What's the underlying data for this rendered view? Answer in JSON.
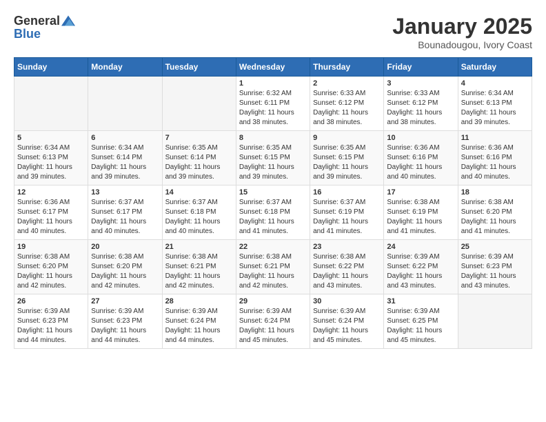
{
  "logo": {
    "general": "General",
    "blue": "Blue"
  },
  "title": "January 2025",
  "subtitle": "Bounadougou, Ivory Coast",
  "days_of_week": [
    "Sunday",
    "Monday",
    "Tuesday",
    "Wednesday",
    "Thursday",
    "Friday",
    "Saturday"
  ],
  "weeks": [
    [
      {
        "day": "",
        "info": "",
        "empty": true
      },
      {
        "day": "",
        "info": "",
        "empty": true
      },
      {
        "day": "",
        "info": "",
        "empty": true
      },
      {
        "day": "1",
        "info": "Sunrise: 6:32 AM\nSunset: 6:11 PM\nDaylight: 11 hours and 38 minutes."
      },
      {
        "day": "2",
        "info": "Sunrise: 6:33 AM\nSunset: 6:12 PM\nDaylight: 11 hours and 38 minutes."
      },
      {
        "day": "3",
        "info": "Sunrise: 6:33 AM\nSunset: 6:12 PM\nDaylight: 11 hours and 38 minutes."
      },
      {
        "day": "4",
        "info": "Sunrise: 6:34 AM\nSunset: 6:13 PM\nDaylight: 11 hours and 39 minutes."
      }
    ],
    [
      {
        "day": "5",
        "info": "Sunrise: 6:34 AM\nSunset: 6:13 PM\nDaylight: 11 hours and 39 minutes."
      },
      {
        "day": "6",
        "info": "Sunrise: 6:34 AM\nSunset: 6:14 PM\nDaylight: 11 hours and 39 minutes."
      },
      {
        "day": "7",
        "info": "Sunrise: 6:35 AM\nSunset: 6:14 PM\nDaylight: 11 hours and 39 minutes."
      },
      {
        "day": "8",
        "info": "Sunrise: 6:35 AM\nSunset: 6:15 PM\nDaylight: 11 hours and 39 minutes."
      },
      {
        "day": "9",
        "info": "Sunrise: 6:35 AM\nSunset: 6:15 PM\nDaylight: 11 hours and 39 minutes."
      },
      {
        "day": "10",
        "info": "Sunrise: 6:36 AM\nSunset: 6:16 PM\nDaylight: 11 hours and 40 minutes."
      },
      {
        "day": "11",
        "info": "Sunrise: 6:36 AM\nSunset: 6:16 PM\nDaylight: 11 hours and 40 minutes."
      }
    ],
    [
      {
        "day": "12",
        "info": "Sunrise: 6:36 AM\nSunset: 6:17 PM\nDaylight: 11 hours and 40 minutes."
      },
      {
        "day": "13",
        "info": "Sunrise: 6:37 AM\nSunset: 6:17 PM\nDaylight: 11 hours and 40 minutes."
      },
      {
        "day": "14",
        "info": "Sunrise: 6:37 AM\nSunset: 6:18 PM\nDaylight: 11 hours and 40 minutes."
      },
      {
        "day": "15",
        "info": "Sunrise: 6:37 AM\nSunset: 6:18 PM\nDaylight: 11 hours and 41 minutes."
      },
      {
        "day": "16",
        "info": "Sunrise: 6:37 AM\nSunset: 6:19 PM\nDaylight: 11 hours and 41 minutes."
      },
      {
        "day": "17",
        "info": "Sunrise: 6:38 AM\nSunset: 6:19 PM\nDaylight: 11 hours and 41 minutes."
      },
      {
        "day": "18",
        "info": "Sunrise: 6:38 AM\nSunset: 6:20 PM\nDaylight: 11 hours and 41 minutes."
      }
    ],
    [
      {
        "day": "19",
        "info": "Sunrise: 6:38 AM\nSunset: 6:20 PM\nDaylight: 11 hours and 42 minutes."
      },
      {
        "day": "20",
        "info": "Sunrise: 6:38 AM\nSunset: 6:20 PM\nDaylight: 11 hours and 42 minutes."
      },
      {
        "day": "21",
        "info": "Sunrise: 6:38 AM\nSunset: 6:21 PM\nDaylight: 11 hours and 42 minutes."
      },
      {
        "day": "22",
        "info": "Sunrise: 6:38 AM\nSunset: 6:21 PM\nDaylight: 11 hours and 42 minutes."
      },
      {
        "day": "23",
        "info": "Sunrise: 6:38 AM\nSunset: 6:22 PM\nDaylight: 11 hours and 43 minutes."
      },
      {
        "day": "24",
        "info": "Sunrise: 6:39 AM\nSunset: 6:22 PM\nDaylight: 11 hours and 43 minutes."
      },
      {
        "day": "25",
        "info": "Sunrise: 6:39 AM\nSunset: 6:23 PM\nDaylight: 11 hours and 43 minutes."
      }
    ],
    [
      {
        "day": "26",
        "info": "Sunrise: 6:39 AM\nSunset: 6:23 PM\nDaylight: 11 hours and 44 minutes."
      },
      {
        "day": "27",
        "info": "Sunrise: 6:39 AM\nSunset: 6:23 PM\nDaylight: 11 hours and 44 minutes."
      },
      {
        "day": "28",
        "info": "Sunrise: 6:39 AM\nSunset: 6:24 PM\nDaylight: 11 hours and 44 minutes."
      },
      {
        "day": "29",
        "info": "Sunrise: 6:39 AM\nSunset: 6:24 PM\nDaylight: 11 hours and 45 minutes."
      },
      {
        "day": "30",
        "info": "Sunrise: 6:39 AM\nSunset: 6:24 PM\nDaylight: 11 hours and 45 minutes."
      },
      {
        "day": "31",
        "info": "Sunrise: 6:39 AM\nSunset: 6:25 PM\nDaylight: 11 hours and 45 minutes."
      },
      {
        "day": "",
        "info": "",
        "empty": true
      }
    ]
  ]
}
